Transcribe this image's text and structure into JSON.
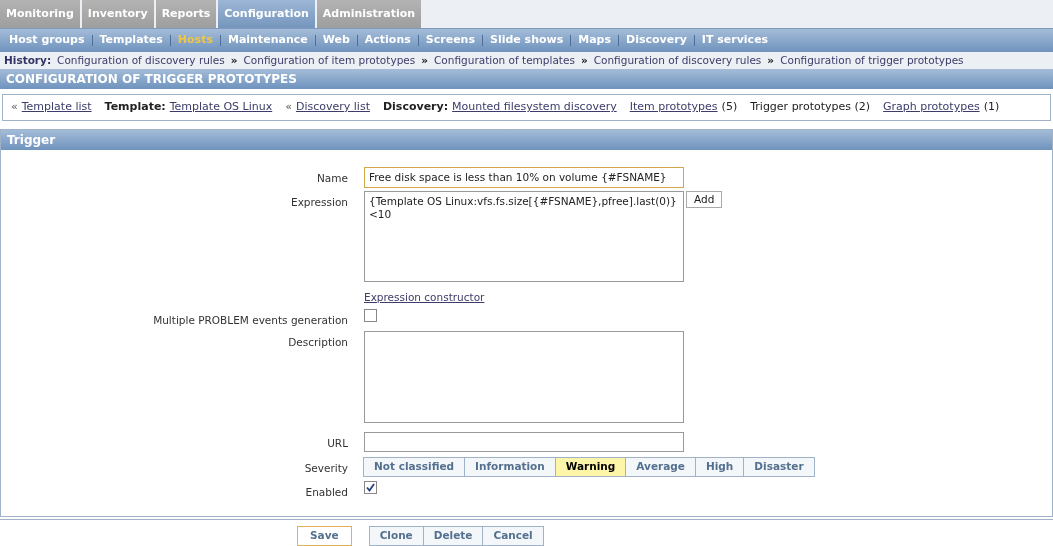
{
  "main_tabs": [
    {
      "label": "Monitoring",
      "selected": false
    },
    {
      "label": "Inventory",
      "selected": false
    },
    {
      "label": "Reports",
      "selected": false
    },
    {
      "label": "Configuration",
      "selected": true
    },
    {
      "label": "Administration",
      "selected": false
    }
  ],
  "sub_menu": [
    {
      "label": "Host groups",
      "selected": false
    },
    {
      "label": "Templates",
      "selected": false
    },
    {
      "label": "Hosts",
      "selected": true
    },
    {
      "label": "Maintenance",
      "selected": false
    },
    {
      "label": "Web",
      "selected": false
    },
    {
      "label": "Actions",
      "selected": false
    },
    {
      "label": "Screens",
      "selected": false
    },
    {
      "label": "Slide shows",
      "selected": false
    },
    {
      "label": "Maps",
      "selected": false
    },
    {
      "label": "Discovery",
      "selected": false
    },
    {
      "label": "IT services",
      "selected": false
    }
  ],
  "history": {
    "label": "History:",
    "separator": "»",
    "items": [
      "Configuration of discovery rules",
      "Configuration of item prototypes",
      "Configuration of templates",
      "Configuration of discovery rules",
      "Configuration of trigger prototypes"
    ]
  },
  "page_title": "CONFIGURATION OF TRIGGER PROTOTYPES",
  "nav": [
    {
      "prefix": "«",
      "link": "Template list"
    },
    {
      "label": "Template:",
      "link": "Template OS Linux"
    },
    {
      "prefix": "«",
      "link": "Discovery list"
    },
    {
      "label": "Discovery:",
      "link": "Mounted filesystem discovery"
    },
    {
      "link": "Item prototypes",
      "count": "(5)"
    },
    {
      "text": "Trigger prototypes (2)"
    },
    {
      "link": "Graph prototypes",
      "count": "(1)"
    }
  ],
  "form": {
    "title": "Trigger",
    "name": {
      "label": "Name",
      "value": "Free disk space is less than 10% on volume {#FSNAME}"
    },
    "expression": {
      "label": "Expression",
      "value": "{Template OS Linux:vfs.fs.size[{#FSNAME},pfree].last(0)}<10",
      "add_button": "Add",
      "constructor_link": "Expression constructor"
    },
    "multiple_events": {
      "label": "Multiple PROBLEM events generation",
      "checked": false
    },
    "description": {
      "label": "Description"
    },
    "url": {
      "label": "URL"
    },
    "severity": {
      "label": "Severity",
      "options": [
        {
          "label": "Not classified",
          "selected": false
        },
        {
          "label": "Information",
          "selected": false
        },
        {
          "label": "Warning",
          "selected": true
        },
        {
          "label": "Average",
          "selected": false
        },
        {
          "label": "High",
          "selected": false
        },
        {
          "label": "Disaster",
          "selected": false
        }
      ]
    },
    "enabled": {
      "label": "Enabled",
      "checked": true
    }
  },
  "buttons": {
    "save": "Save",
    "others": [
      "Clone",
      "Delete",
      "Cancel"
    ]
  }
}
